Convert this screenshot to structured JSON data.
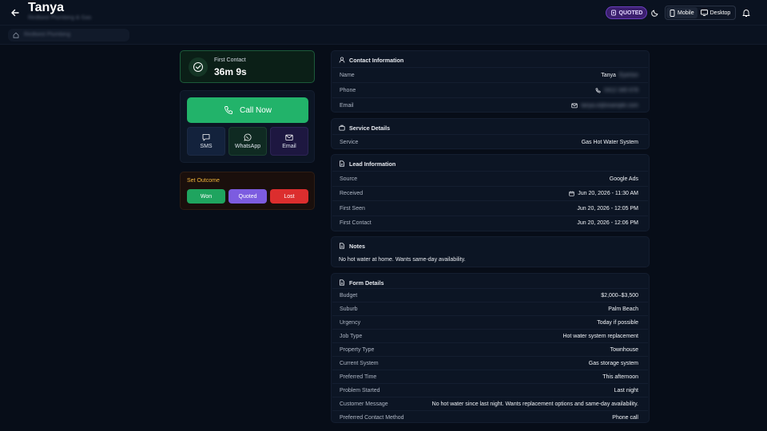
{
  "header": {
    "title": "Tanya",
    "subtitle": "Redtwist Plumbing & Gas",
    "status_badge": "QUOTED",
    "view_mobile": "Mobile",
    "view_desktop": "Desktop"
  },
  "breadcrumb": {
    "text": "Redtwist Plumbing"
  },
  "first_contact": {
    "label": "First Contact",
    "value": "36m 9s"
  },
  "actions": {
    "call": "Call Now",
    "sms": "SMS",
    "whatsapp": "WhatsApp",
    "email": "Email"
  },
  "outcome": {
    "title": "Set Outcome",
    "won": "Won",
    "quoted": "Quoted",
    "lost": "Lost"
  },
  "contact": {
    "title": "Contact Information",
    "name_label": "Name",
    "name_value": "Tanya",
    "name_hidden": "Eyerton",
    "phone_label": "Phone",
    "phone_value": "0412 345 678",
    "email_label": "Email",
    "email_value": "tanya.e@example.com"
  },
  "service": {
    "title": "Service Details",
    "label": "Service",
    "value": "Gas Hot Water System"
  },
  "lead": {
    "title": "Lead Information",
    "rows": [
      {
        "label": "Source",
        "value": "Google Ads"
      },
      {
        "label": "Received",
        "value": "Jun 20, 2026 - 11:30 AM"
      },
      {
        "label": "First Seen",
        "value": "Jun 20, 2026 - 12:05 PM"
      },
      {
        "label": "First Contact",
        "value": "Jun 20, 2026 - 12:06 PM"
      }
    ]
  },
  "notes": {
    "title": "Notes",
    "text": "No hot water at home. Wants same-day availability."
  },
  "form": {
    "title": "Form Details",
    "rows": [
      {
        "label": "Budget",
        "value": "$2,000–$3,500"
      },
      {
        "label": "Suburb",
        "value": "Palm Beach"
      },
      {
        "label": "Urgency",
        "value": "Today if possible"
      },
      {
        "label": "Job Type",
        "value": "Hot water system replacement"
      },
      {
        "label": "Property Type",
        "value": "Townhouse"
      },
      {
        "label": "Current System",
        "value": "Gas storage system"
      },
      {
        "label": "Preferred Time",
        "value": "This afternoon"
      },
      {
        "label": "Problem Started",
        "value": "Last night"
      },
      {
        "label": "Customer Message",
        "value": "No hot water since last night. Wants replacement options and same-day availability."
      },
      {
        "label": "Preferred Contact Method",
        "value": "Phone call"
      }
    ]
  },
  "colors": {
    "background": "#070d18",
    "call_green": "#22b36a",
    "won_green": "#1fa45f",
    "quoted_purple": "#7c5ce0",
    "lost_red": "#dc2e2e",
    "outcome_title": "#f2b63c"
  },
  "icons": [
    "back-arrow-icon",
    "quoted-badge-icon",
    "theme-moon-icon",
    "mobile-icon",
    "desktop-icon",
    "bell-icon",
    "home-icon",
    "check-circle-icon",
    "phone-icon",
    "sms-icon",
    "whatsapp-icon",
    "email-icon",
    "user-icon",
    "briefcase-icon",
    "document-icon",
    "notes-icon",
    "form-icon",
    "calendar-icon"
  ]
}
